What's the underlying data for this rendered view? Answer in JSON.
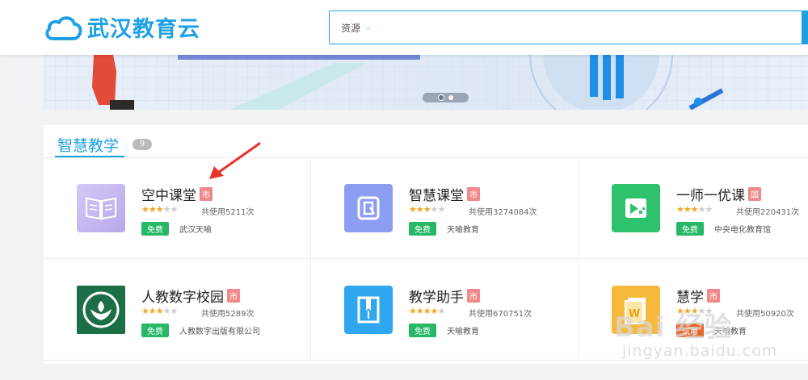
{
  "header": {
    "logo_text": "武汉教育云",
    "search_type": "资源"
  },
  "banner": {
    "slide_count": 2,
    "active_slide": 1
  },
  "section": {
    "title": "智慧教学",
    "count": "9"
  },
  "apps": [
    {
      "name": "空中课堂",
      "level": "市",
      "rating": 3,
      "usage": "共使用5211次",
      "price": "免费",
      "publisher": "武汉天喻",
      "icon": "book-icon",
      "color": "#c8b8ee"
    },
    {
      "name": "智慧课堂",
      "level": "市",
      "rating": 3,
      "usage": "共使用3274084次",
      "price": "免费",
      "publisher": "天喻教育",
      "icon": "screen-icon",
      "color": "#8b9ef2"
    },
    {
      "name": "一师一优课",
      "level": "国",
      "rating": 3,
      "usage": "共使用220431次",
      "price": "免费",
      "publisher": "中央电化教育馆",
      "icon": "video-icon",
      "color": "#2fc26c"
    },
    {
      "name": "人教数字校园",
      "level": "市",
      "rating": 3,
      "usage": "共使用5289次",
      "price": "免费",
      "publisher": "人教数字出版有限公司",
      "icon": "pep-logo-icon",
      "color": "#1b6e45"
    },
    {
      "name": "教学助手",
      "level": "市",
      "rating": 4,
      "usage": "共使用670751次",
      "price": "免费",
      "publisher": "天喻教育",
      "icon": "notebook-icon",
      "color": "#2fa6f0"
    },
    {
      "name": "慧学",
      "level": "市",
      "rating": 3,
      "usage": "共使用50920次",
      "price": "试用",
      "publisher": "天喻教育",
      "icon": "document-icon",
      "color": "#f6b93b"
    }
  ],
  "watermark": {
    "brand": "Bai 经验",
    "url": "jingyan.baidu.com"
  }
}
